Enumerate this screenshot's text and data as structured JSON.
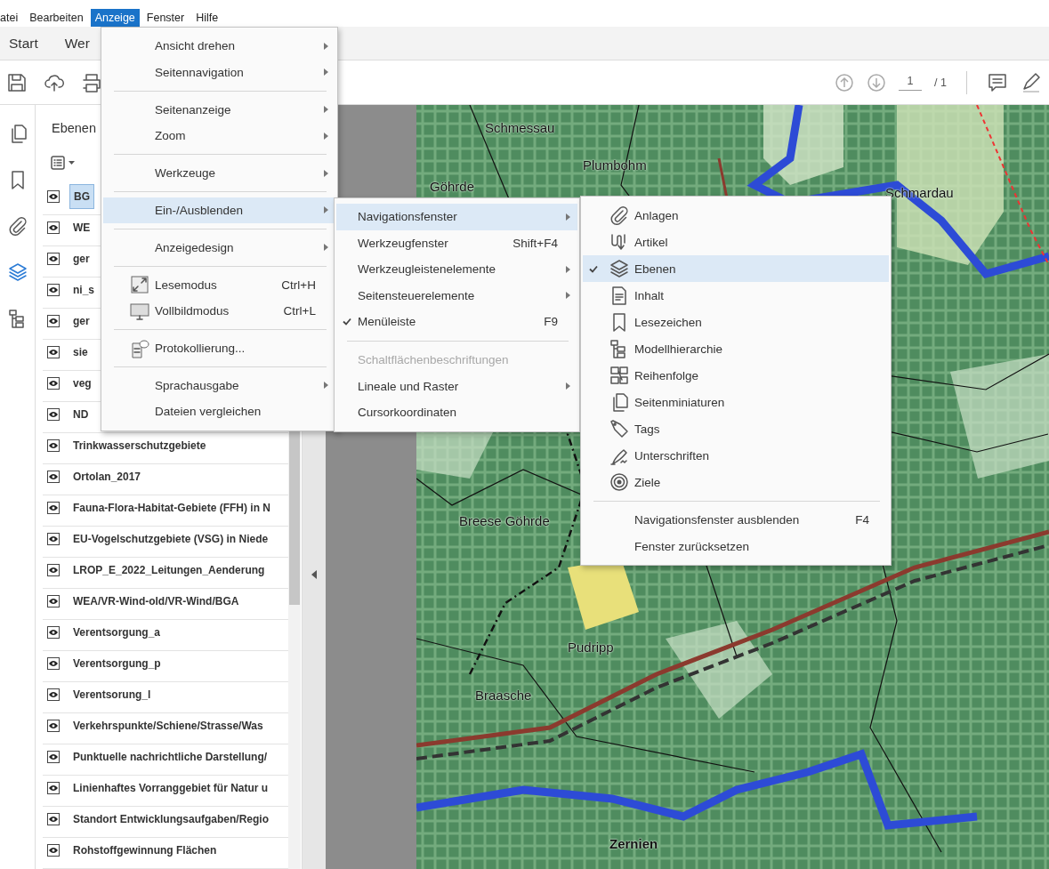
{
  "menu_bar": [
    {
      "label": "atei",
      "selected": false
    },
    {
      "label": "Bearbeiten",
      "selected": false
    },
    {
      "label": "Anzeige",
      "selected": true
    },
    {
      "label": "Fenster",
      "selected": false
    },
    {
      "label": "Hilfe",
      "selected": false
    }
  ],
  "tabs": [
    {
      "label": "Start"
    },
    {
      "label": "Wer"
    }
  ],
  "toolbar": {
    "page_number": "1",
    "page_total": "/ 1"
  },
  "nav_rail": [
    {
      "selected": false
    },
    {
      "selected": false
    },
    {
      "selected": false
    },
    {
      "selected": true
    },
    {
      "selected": false
    }
  ],
  "layers_panel": {
    "title": "Ebenen",
    "layers": [
      {
        "name": "BG",
        "visible": true,
        "selected": true
      },
      {
        "name": "WE",
        "visible": true,
        "selected": false
      },
      {
        "name": "ger",
        "visible": true,
        "selected": false
      },
      {
        "name": "ni_s",
        "visible": true,
        "selected": false
      },
      {
        "name": "ger",
        "visible": true,
        "selected": false
      },
      {
        "name": "sie",
        "visible": true,
        "selected": false
      },
      {
        "name": "veg",
        "visible": true,
        "selected": false
      },
      {
        "name": "ND",
        "visible": true,
        "selected": false
      },
      {
        "name": "Trinkwasserschutzgebiete",
        "visible": true,
        "selected": false
      },
      {
        "name": "Ortolan_2017",
        "visible": true,
        "selected": false
      },
      {
        "name": "Fauna-Flora-Habitat-Gebiete (FFH) in N",
        "visible": true,
        "selected": false
      },
      {
        "name": "EU-Vogelschutzgebiete (VSG) in Niede",
        "visible": true,
        "selected": false
      },
      {
        "name": "LROP_E_2022_Leitungen_Aenderung",
        "visible": true,
        "selected": false
      },
      {
        "name": "WEA/VR-Wind-old/VR-Wind/BGA",
        "visible": true,
        "selected": false
      },
      {
        "name": "Verentsorgung_a",
        "visible": true,
        "selected": false
      },
      {
        "name": "Verentsorgung_p",
        "visible": true,
        "selected": false
      },
      {
        "name": "Verentsorung_l",
        "visible": true,
        "selected": false
      },
      {
        "name": "Verkehrspunkte/Schiene/Strasse/Was",
        "visible": true,
        "selected": false
      },
      {
        "name": "Punktuelle nachrichtliche Darstellung/",
        "visible": true,
        "selected": false
      },
      {
        "name": "Linienhaftes Vorranggebiet für Natur u",
        "visible": true,
        "selected": false
      },
      {
        "name": "Standort Entwicklungsaufgaben/Regio",
        "visible": true,
        "selected": false
      },
      {
        "name": "Rohstoffgewinnung Flächen",
        "visible": true,
        "selected": false
      }
    ]
  },
  "map": {
    "labels": [
      {
        "text": "Schmessau"
      },
      {
        "text": "Plumbohm"
      },
      {
        "text": "Göhrde"
      },
      {
        "text": "Schmardau"
      },
      {
        "text": "Breese Göhrde"
      },
      {
        "text": "Pudripp"
      },
      {
        "text": "Braasche"
      },
      {
        "text": "Zernien"
      }
    ]
  },
  "menus": [
    {
      "items": [
        {
          "kind": "item",
          "label": "Ansicht drehen",
          "submenu": true,
          "checked": false,
          "selected": false,
          "disabled": false
        },
        {
          "kind": "item",
          "label": "Seitennavigation",
          "submenu": true,
          "checked": false,
          "selected": false,
          "disabled": false
        },
        {
          "kind": "separator"
        },
        {
          "kind": "item",
          "label": "Seitenanzeige",
          "submenu": true,
          "checked": false,
          "selected": false,
          "disabled": false
        },
        {
          "kind": "item",
          "label": "Zoom",
          "submenu": true,
          "checked": false,
          "selected": false,
          "disabled": false
        },
        {
          "kind": "separator"
        },
        {
          "kind": "item",
          "label": "Werkzeuge",
          "submenu": true,
          "checked": false,
          "selected": false,
          "disabled": false
        },
        {
          "kind": "separator"
        },
        {
          "kind": "item",
          "label": "Ein-/Ausblenden",
          "submenu": true,
          "checked": false,
          "selected": true,
          "disabled": false
        },
        {
          "kind": "separator"
        },
        {
          "kind": "item",
          "label": "Anzeigedesign",
          "submenu": true,
          "checked": false,
          "selected": false,
          "disabled": false
        },
        {
          "kind": "separator"
        },
        {
          "kind": "item",
          "label": "Lesemodus",
          "shortcut": "Ctrl+H",
          "submenu": false,
          "checked": false,
          "selected": false,
          "disabled": false
        },
        {
          "kind": "item",
          "label": "Vollbildmodus",
          "shortcut": "Ctrl+L",
          "submenu": false,
          "checked": false,
          "selected": false,
          "disabled": false
        },
        {
          "kind": "separator"
        },
        {
          "kind": "item",
          "label": "Protokollierung...",
          "submenu": false,
          "checked": false,
          "selected": false,
          "disabled": false
        },
        {
          "kind": "separator"
        },
        {
          "kind": "item",
          "label": "Sprachausgabe",
          "submenu": true,
          "checked": false,
          "selected": false,
          "disabled": false
        },
        {
          "kind": "item",
          "label": "Dateien vergleichen",
          "submenu": false,
          "checked": false,
          "selected": false,
          "disabled": false
        }
      ]
    },
    {
      "items": [
        {
          "kind": "item",
          "label": "Navigationsfenster",
          "submenu": true,
          "checked": false,
          "selected": true,
          "disabled": false
        },
        {
          "kind": "item",
          "label": "Werkzeugfenster",
          "shortcut": "Shift+F4",
          "submenu": false,
          "checked": false,
          "selected": false,
          "disabled": false
        },
        {
          "kind": "item",
          "label": "Werkzeugleistenelemente",
          "submenu": true,
          "checked": false,
          "selected": false,
          "disabled": false
        },
        {
          "kind": "item",
          "label": "Seitensteuerelemente",
          "submenu": true,
          "checked": false,
          "selected": false,
          "disabled": false
        },
        {
          "kind": "item",
          "label": "Menüleiste",
          "shortcut": "F9",
          "submenu": false,
          "checked": true,
          "selected": false,
          "disabled": false
        },
        {
          "kind": "separator"
        },
        {
          "kind": "item",
          "label": "Schaltflächenbeschriftungen",
          "submenu": false,
          "checked": false,
          "selected": false,
          "disabled": true
        },
        {
          "kind": "item",
          "label": "Lineale und Raster",
          "submenu": true,
          "checked": false,
          "selected": false,
          "disabled": false
        },
        {
          "kind": "item",
          "label": "Cursorkoordinaten",
          "submenu": false,
          "checked": false,
          "selected": false,
          "disabled": false
        }
      ]
    },
    {
      "items": [
        {
          "kind": "item",
          "label": "Anlagen",
          "submenu": false,
          "checked": false,
          "selected": false,
          "disabled": false
        },
        {
          "kind": "item",
          "label": "Artikel",
          "submenu": false,
          "checked": false,
          "selected": false,
          "disabled": false
        },
        {
          "kind": "item",
          "label": "Ebenen",
          "submenu": false,
          "checked": true,
          "selected": true,
          "disabled": false
        },
        {
          "kind": "item",
          "label": "Inhalt",
          "submenu": false,
          "checked": false,
          "selected": false,
          "disabled": false
        },
        {
          "kind": "item",
          "label": "Lesezeichen",
          "submenu": false,
          "checked": false,
          "selected": false,
          "disabled": false
        },
        {
          "kind": "item",
          "label": "Modellhierarchie",
          "submenu": false,
          "checked": false,
          "selected": false,
          "disabled": false
        },
        {
          "kind": "item",
          "label": "Reihenfolge",
          "submenu": false,
          "checked": false,
          "selected": false,
          "disabled": false
        },
        {
          "kind": "item",
          "label": "Seitenminiaturen",
          "submenu": false,
          "checked": false,
          "selected": false,
          "disabled": false
        },
        {
          "kind": "item",
          "label": "Tags",
          "submenu": false,
          "checked": false,
          "selected": false,
          "disabled": false
        },
        {
          "kind": "item",
          "label": "Unterschriften",
          "submenu": false,
          "checked": false,
          "selected": false,
          "disabled": false
        },
        {
          "kind": "item",
          "label": "Ziele",
          "submenu": false,
          "checked": false,
          "selected": false,
          "disabled": false
        },
        {
          "kind": "separator"
        },
        {
          "kind": "item",
          "label": "Navigationsfenster ausblenden",
          "shortcut": "F4",
          "submenu": false,
          "checked": false,
          "selected": false,
          "disabled": false
        },
        {
          "kind": "item",
          "label": "Fenster zurücksetzen",
          "submenu": false,
          "checked": false,
          "selected": false,
          "disabled": false
        }
      ]
    }
  ]
}
